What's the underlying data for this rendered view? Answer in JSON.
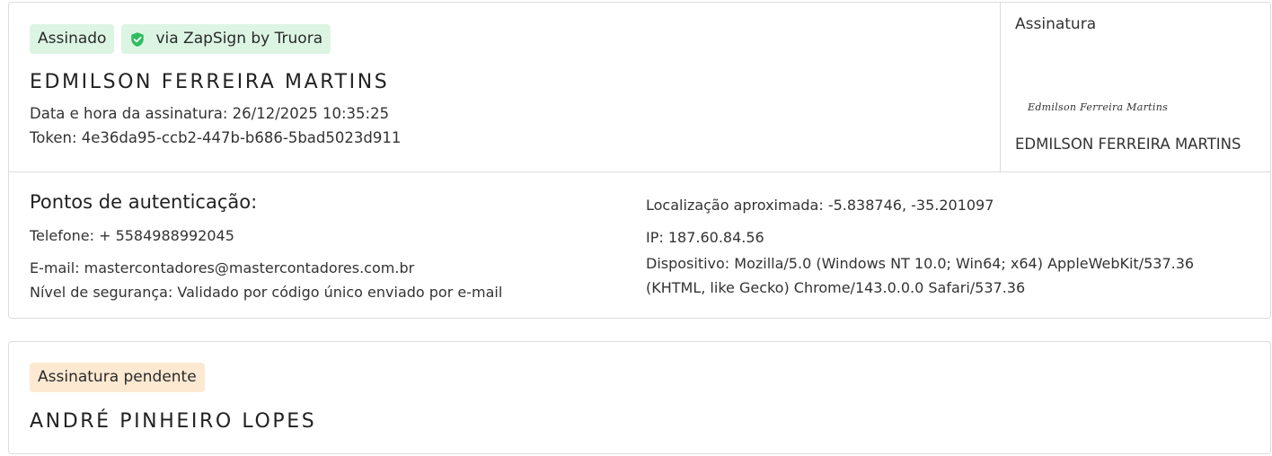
{
  "signer1": {
    "status_badge": "Assinado",
    "provider_badge": "via ZapSign by Truora",
    "name": "EDMILSON FERREIRA MARTINS",
    "date_line": "Data e hora da assinatura: 26/12/2025 10:35:25",
    "token_line": "Token: 4e36da95-ccb2-447b-b686-5bad5023d911",
    "signature_panel": {
      "label": "Assinatura",
      "signature_image_text": "Edmilson Ferreira Martins",
      "printed_name": "EDMILSON FERREIRA MARTINS"
    },
    "auth": {
      "title": "Pontos de autenticação:",
      "phone": "Telefone: + 5584988992045",
      "email": "E-mail: mastercontadores@mastercontadores.com.br",
      "security_level": "Nível de segurança: Validado por código único enviado por e-mail",
      "location": "Localização aproximada: -5.838746, -35.201097",
      "ip": "IP: 187.60.84.56",
      "device_line1": "Dispositivo: Mozilla/5.0 (Windows NT 10.0; Win64; x64) AppleWebKit/537.36",
      "device_line2": "(KHTML, like Gecko) Chrome/143.0.0.0 Safari/537.36"
    }
  },
  "signer2": {
    "status_badge": "Assinatura pendente",
    "name": "ANDRÉ PINHEIRO LOPES"
  },
  "colors": {
    "signed_badge_bg": "#dcf5e3",
    "pending_badge_bg": "#fde9d2",
    "shield_green": "#2ebd5f",
    "border": "#dcdcdc"
  },
  "icons": {
    "provider_badge_icon": "shield-check-icon"
  }
}
